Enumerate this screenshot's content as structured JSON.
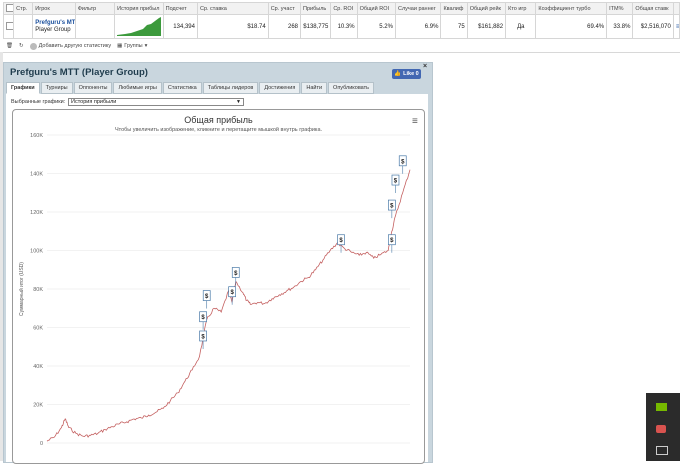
{
  "table": {
    "headers": [
      "Стр.",
      "Игрок",
      "Фильтр",
      "История прибыл",
      "Подсчет",
      "Ср. ставка",
      "Ср. участ",
      "Прибыль",
      "Ср. ROI",
      "Общий ROI",
      "Случаи раннег",
      "Квалиф",
      "Общий рейк",
      "Кто игр",
      "Коэффициент турбо",
      "ITM%",
      "Общая ставк"
    ],
    "row": {
      "player_name": "Prefguru's MTT",
      "player_group": "Player Group",
      "count": "134,394",
      "avg_stake": "$18.74",
      "avg_entrants": "268",
      "profit": "$138,775",
      "avg_roi": "10.3%",
      "total_roi": "5.2%",
      "early_cases": "6.9%",
      "qualif": "75",
      "total_rake": "$161,882",
      "who_plays": "Да",
      "turbo_ratio": "69.4%",
      "itm": "33.8%",
      "total_stake": "$2,516,070"
    }
  },
  "toolbar": {
    "add_stat": "Добавить другую статистику",
    "groups": "Группы"
  },
  "panel": {
    "title": "Prefguru's MTT (Player Group)",
    "like": "Like 0",
    "close": "×",
    "tabs": [
      "Графики",
      "Турниры",
      "Оппоненты",
      "Любимые игры",
      "Статистика",
      "Таблицы лидеров",
      "Достижения",
      "Найти",
      "Опубликовать"
    ],
    "active_tab": 0,
    "selected_label": "Выбранные графики:",
    "selected_value": "История прибыли"
  },
  "chart_data": {
    "type": "line",
    "title": "Общая прибыль",
    "subtitle": "Чтобы увеличить изображение, кликните и перетащите мышкой внутрь графика.",
    "ylabel": "Суммарный итог (USD)",
    "xlabel": "",
    "ylim": [
      0,
      160000
    ],
    "yticks": [
      0,
      20000,
      40000,
      60000,
      80000,
      100000,
      120000,
      140000,
      160000
    ],
    "ytick_labels": [
      "0",
      "20K",
      "40K",
      "60K",
      "80K",
      "100K",
      "120K",
      "140K",
      "160K"
    ],
    "grid": true,
    "series": [
      {
        "color": "#c46060",
        "x": [
          0,
          2,
          4,
          5,
          6,
          8,
          10,
          12,
          14,
          16,
          18,
          20,
          22,
          24,
          26,
          28,
          30,
          32,
          34,
          36,
          38,
          40,
          42,
          44,
          46,
          48,
          50,
          51,
          52,
          54,
          55,
          56,
          58,
          60,
          62,
          64,
          66,
          68,
          70,
          72,
          74,
          76,
          78,
          80,
          82,
          84,
          86,
          88,
          90,
          92,
          94,
          95,
          96,
          98,
          100
        ],
        "values": [
          1000,
          3000,
          8000,
          12500,
          8000,
          5000,
          3500,
          4000,
          5000,
          7000,
          8500,
          10000,
          11000,
          12500,
          13000,
          14500,
          16000,
          18000,
          22000,
          26000,
          32000,
          38000,
          45000,
          64000,
          70000,
          68000,
          79000,
          73000,
          84000,
          78000,
          74000,
          72000,
          73000,
          72500,
          75000,
          77000,
          79000,
          81000,
          84000,
          86000,
          90000,
          95000,
          100000,
          104000,
          101000,
          99000,
          97500,
          99000,
          96000,
          98000,
          100000,
          110000,
          118000,
          130000,
          142000
        ]
      }
    ],
    "annotations": [
      {
        "label": "$",
        "x": 43,
        "y": 53000
      },
      {
        "label": "$",
        "x": 43,
        "y": 63000
      },
      {
        "label": "$",
        "x": 44,
        "y": 74000
      },
      {
        "label": "$",
        "x": 51,
        "y": 76000
      },
      {
        "label": "$",
        "x": 52,
        "y": 86000
      },
      {
        "label": "$",
        "x": 81,
        "y": 103000
      },
      {
        "label": "$",
        "x": 95,
        "y": 103000
      },
      {
        "label": "$",
        "x": 95,
        "y": 121000
      },
      {
        "label": "$",
        "x": 96,
        "y": 134000
      },
      {
        "label": "$",
        "x": 98,
        "y": 144000
      }
    ]
  }
}
